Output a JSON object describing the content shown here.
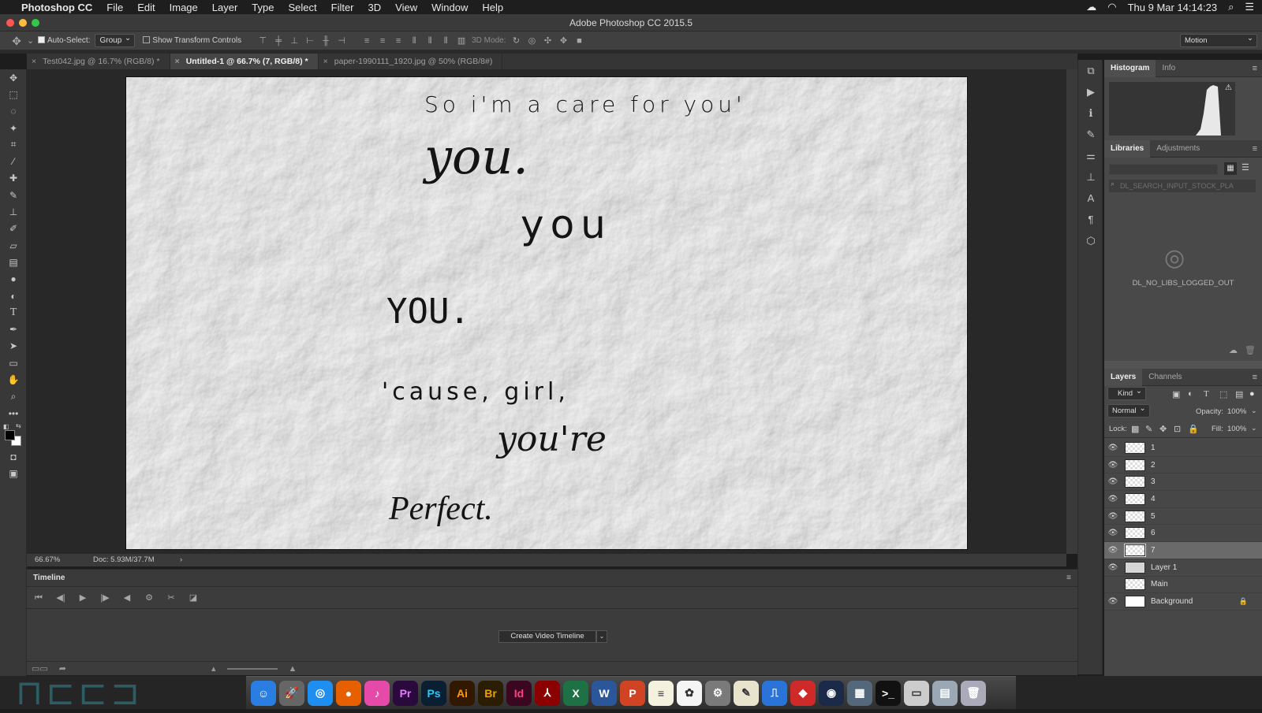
{
  "menubar": {
    "apple": "",
    "app": "Photoshop CC",
    "items": [
      "File",
      "Edit",
      "Image",
      "Layer",
      "Type",
      "Select",
      "Filter",
      "3D",
      "View",
      "Window",
      "Help"
    ],
    "clock": "Thu 9 Mar  14:14:23"
  },
  "window": {
    "title": "Adobe Photoshop CC 2015.5"
  },
  "options": {
    "auto_select_label": "Auto-Select:",
    "auto_select_value": "Group",
    "transform_label": "Show Transform Controls",
    "mode3d_label": "3D Mode:",
    "workspace": "Motion"
  },
  "tabs": [
    {
      "label": "Test042.jpg @ 16.7% (RGB/8) *"
    },
    {
      "label": "Untitled-1 @ 66.7% (7, RGB/8) *"
    },
    {
      "label": "paper-1990111_1920.jpg @ 50% (RGB/8#)"
    }
  ],
  "canvas": {
    "lines": [
      "So i'm a care for you'",
      "you.",
      "you",
      "YOU.",
      "'cause, girl,",
      "you're",
      "Perfect."
    ]
  },
  "status": {
    "zoom": "66.67%",
    "doc": "Doc: 5.93M/37.7M",
    "arrow": "›"
  },
  "timeline": {
    "title": "Timeline",
    "create_button": "Create Video Timeline",
    "dropdown_arrow": "⌄"
  },
  "histogram": {
    "tab1": "Histogram",
    "tab2": "Info",
    "warning": "⚠"
  },
  "libraries": {
    "tab1": "Libraries",
    "tab2": "Adjustments",
    "search_placeholder": "DL_SEARCH_INPUT_STOCK_PLA",
    "logged_out": "DL_NO_LIBS_LOGGED_OUT"
  },
  "layers": {
    "tab1": "Layers",
    "tab2": "Channels",
    "kind": "Kind",
    "blend": "Normal",
    "opacity_label": "Opacity:",
    "opacity": "100%",
    "lock_label": "Lock:",
    "fill_label": "Fill:",
    "fill": "100%",
    "items": [
      {
        "name": "1",
        "visible": true
      },
      {
        "name": "2",
        "visible": true
      },
      {
        "name": "3",
        "visible": true
      },
      {
        "name": "4",
        "visible": true
      },
      {
        "name": "5",
        "visible": true
      },
      {
        "name": "6",
        "visible": true
      },
      {
        "name": "7",
        "visible": true,
        "selected": true
      },
      {
        "name": "Layer 1",
        "visible": true
      },
      {
        "name": "Main",
        "visible": false
      },
      {
        "name": "Background",
        "visible": true,
        "locked": true
      }
    ]
  },
  "dock": {
    "apps": [
      {
        "name": "finder",
        "glyph": "☺",
        "color": "#2a7de1"
      },
      {
        "name": "launchpad",
        "glyph": "🚀",
        "color": "#666"
      },
      {
        "name": "safari",
        "glyph": "◎",
        "color": "#1f8ef1"
      },
      {
        "name": "firefox",
        "glyph": "●",
        "color": "#e66000"
      },
      {
        "name": "itunes",
        "glyph": "♪",
        "color": "#e64aa8"
      },
      {
        "name": "premiere",
        "glyph": "Pr",
        "color": "#2a0a3c"
      },
      {
        "name": "photoshop",
        "glyph": "Ps",
        "color": "#0b1f33"
      },
      {
        "name": "illustrator",
        "glyph": "Ai",
        "color": "#331800"
      },
      {
        "name": "bridge",
        "glyph": "Br",
        "color": "#2b1d00"
      },
      {
        "name": "indesign",
        "glyph": "Id",
        "color": "#3a0620"
      },
      {
        "name": "acrobat",
        "glyph": "⅄",
        "color": "#8b0000"
      },
      {
        "name": "excel",
        "glyph": "X",
        "color": "#1e7145"
      },
      {
        "name": "word",
        "glyph": "W",
        "color": "#2b579a"
      },
      {
        "name": "powerpoint",
        "glyph": "P",
        "color": "#d04423"
      },
      {
        "name": "notes",
        "glyph": "≡",
        "color": "#f4f1de"
      },
      {
        "name": "photos",
        "glyph": "✿",
        "color": "#f5f5f5"
      },
      {
        "name": "system-preferences",
        "glyph": "⚙",
        "color": "#7a7a7a"
      },
      {
        "name": "textedit",
        "glyph": "✎",
        "color": "#e8e3cc"
      },
      {
        "name": "keynote",
        "glyph": "⎍",
        "color": "#2a73d9"
      },
      {
        "name": "sketchup",
        "glyph": "◆",
        "color": "#cf2a2a"
      },
      {
        "name": "cinema4d",
        "glyph": "◉",
        "color": "#1c2a4a"
      },
      {
        "name": "screenshots",
        "glyph": "▦",
        "color": "#55677a"
      },
      {
        "name": "terminal",
        "glyph": ">_",
        "color": "#111"
      },
      {
        "name": "document-stack",
        "glyph": "▭",
        "color": "#ccc"
      },
      {
        "name": "downloads",
        "glyph": "▤",
        "color": "#9aa7b5"
      },
      {
        "name": "trash",
        "glyph": "🗑",
        "color": "#aab"
      }
    ]
  }
}
